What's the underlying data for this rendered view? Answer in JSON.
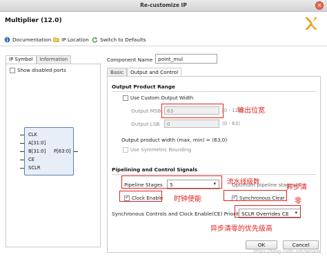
{
  "window": {
    "title": "Re-customize IP"
  },
  "header": {
    "ip_title": "Multiplier (12.0)"
  },
  "toolbar": {
    "documentation": "Documentation",
    "ip_location": "IP Location",
    "switch_defaults": "Switch to Defaults"
  },
  "left": {
    "tabs": [
      "IP Symbol",
      "Information"
    ],
    "show_disabled_ports": "Show disabled ports",
    "ports_in": [
      "CLK",
      "A[31:0]",
      "B[31:0]",
      "CE",
      "SCLR"
    ],
    "port_out": "P[63:0]"
  },
  "right": {
    "component_name_label": "Component Name",
    "component_name_value": "point_mul",
    "tabs": [
      "Basic",
      "Output and Control"
    ],
    "output_product_range": {
      "title": "Output Product Range",
      "use_custom_width": "Use Custom Output Width",
      "output_msb_label": "Output MSB",
      "output_msb_value": "63",
      "output_msb_range": "[0 - 127]",
      "output_lsb_label": "Output LSB",
      "output_lsb_value": "0",
      "output_lsb_range": "(0 - 63)",
      "product_width_text": "Output product width (max, min) = (63,0)",
      "use_symmetric_rounding": "Use Symmetric Rounding"
    },
    "pipelining": {
      "title": "Pipelining and Control Signals",
      "pipeline_stages_label": "Pipeline Stages",
      "pipeline_stages_value": "5",
      "optimum_text": "Optimum pipeline stages: 6",
      "clock_enable": "Clock Enable",
      "synchronous_clear": "Synchronous Clear",
      "priority_label": "Synchronous Controls and Clock Enable(CE) Priority",
      "priority_value": "SCLR Overrides CE"
    },
    "buttons": {
      "ok": "OK",
      "cancel": "Cancel"
    }
  },
  "annotations": {
    "output_width": "输出位宽",
    "pipeline_stages": "流水线级数",
    "sync_clear_1": "异步清",
    "sync_clear_2": "零",
    "clock_enable": "时钟使能",
    "priority": "异步清零的优先级高"
  },
  "watermark": "https://blog.csdn.net/weixin_",
  "colors": {
    "annotation": "#e0201b",
    "symbol_border": "#5a7fb0",
    "logo": "#e8a31f"
  }
}
